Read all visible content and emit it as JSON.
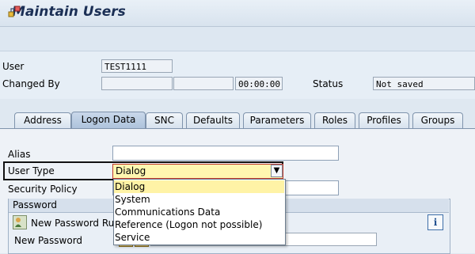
{
  "title": "Maintain Users",
  "toolbar": {
    "icon": "hierarchy-icon"
  },
  "header": {
    "user_label": "User",
    "user_value": "TEST1111",
    "changed_by_label": "Changed By",
    "changed_by_value": "",
    "changed_date_value": "",
    "changed_time_value": "00:00:00",
    "status_label": "Status",
    "status_value": "Not saved"
  },
  "tabs": [
    {
      "label": "Address"
    },
    {
      "label": "Logon Data"
    },
    {
      "label": "SNC"
    },
    {
      "label": "Defaults"
    },
    {
      "label": "Parameters"
    },
    {
      "label": "Roles"
    },
    {
      "label": "Profiles"
    },
    {
      "label": "Groups"
    }
  ],
  "active_tab": "Logon Data",
  "form": {
    "alias_label": "Alias",
    "alias_value": "",
    "user_type_label": "User Type",
    "user_type_value": "Dialog",
    "security_policy_label": "Security Policy",
    "security_policy_value": ""
  },
  "password": {
    "group_title": "Password",
    "new_rules_label": "New Password Rules",
    "new_password_label": "New Password",
    "masked_value": "**********************"
  },
  "dropdown": {
    "options": [
      "Dialog",
      "System",
      "Communications Data",
      "Reference (Logon not possible)",
      "Service"
    ],
    "selected": "Dialog"
  },
  "colors": {
    "title": "#1b2f55",
    "selected_option": "#fff3a6",
    "highlight_border": "#111111"
  }
}
